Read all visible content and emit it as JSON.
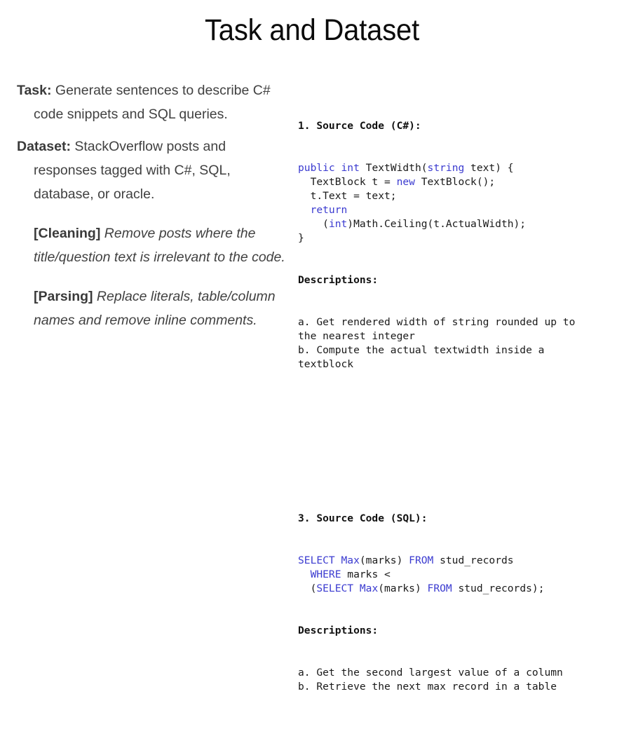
{
  "slide": {
    "title": "Task and Dataset",
    "background": "#ffffff",
    "body_color": "#414141",
    "keyword_color": "#3b3bd0"
  },
  "left": {
    "task": {
      "label": "Task:",
      "text": " Generate sentences to describe C# code snippets and SQL queries."
    },
    "dataset": {
      "label": "Dataset:",
      "text": " StackOverflow posts and responses tagged with C#, SQL, database, or oracle."
    },
    "cleaning": {
      "tag": "[Cleaning]",
      "text": " Remove posts where the title/question text is irrelevant to the code."
    },
    "parsing": {
      "tag": "[Parsing]",
      "text": " Replace literals, table/column names and remove inline comments."
    }
  },
  "right": {
    "csharp": {
      "header": "1. Source Code (C#):",
      "code_lines": [
        [
          {
            "t": "public ",
            "c": "kw"
          },
          {
            "t": "int ",
            "c": "kw"
          },
          {
            "t": "TextWidth(",
            "c": "plain"
          },
          {
            "t": "string",
            "c": "kw"
          },
          {
            "t": " text) {",
            "c": "plain"
          }
        ],
        [
          {
            "t": "  TextBlock t = ",
            "c": "plain"
          },
          {
            "t": "new",
            "c": "kw"
          },
          {
            "t": " TextBlock();",
            "c": "plain"
          }
        ],
        [
          {
            "t": "  t.Text = text;",
            "c": "plain"
          }
        ],
        [
          {
            "t": "  ",
            "c": "plain"
          },
          {
            "t": "return",
            "c": "kw"
          }
        ],
        [
          {
            "t": "    (",
            "c": "plain"
          },
          {
            "t": "int",
            "c": "kw"
          },
          {
            "t": ")Math.Ceiling(t.ActualWidth);",
            "c": "plain"
          }
        ],
        [
          {
            "t": "}",
            "c": "plain"
          }
        ]
      ],
      "descriptions_header": "Descriptions:",
      "descriptions": [
        "a. Get rendered width of string rounded up to",
        "the nearest integer",
        "b. Compute the actual textwidth inside a",
        "textblock"
      ]
    },
    "sql": {
      "header": "3. Source Code (SQL):",
      "code_lines": [
        [
          {
            "t": "SELECT",
            "c": "kw"
          },
          {
            "t": " ",
            "c": "plain"
          },
          {
            "t": "Max",
            "c": "kw"
          },
          {
            "t": "(marks) ",
            "c": "plain"
          },
          {
            "t": "FROM",
            "c": "kw"
          },
          {
            "t": " stud_records",
            "c": "plain"
          }
        ],
        [
          {
            "t": "  ",
            "c": "plain"
          },
          {
            "t": "WHERE",
            "c": "kw"
          },
          {
            "t": " marks <",
            "c": "plain"
          }
        ],
        [
          {
            "t": "  (",
            "c": "plain"
          },
          {
            "t": "SELECT",
            "c": "kw"
          },
          {
            "t": " ",
            "c": "plain"
          },
          {
            "t": "Max",
            "c": "kw"
          },
          {
            "t": "(marks) ",
            "c": "plain"
          },
          {
            "t": "FROM",
            "c": "kw"
          },
          {
            "t": " stud_records);",
            "c": "plain"
          }
        ]
      ],
      "descriptions_header": "Descriptions:",
      "descriptions": [
        "a. Get the second largest value of a column",
        "b. Retrieve the next max record in a table"
      ]
    }
  }
}
